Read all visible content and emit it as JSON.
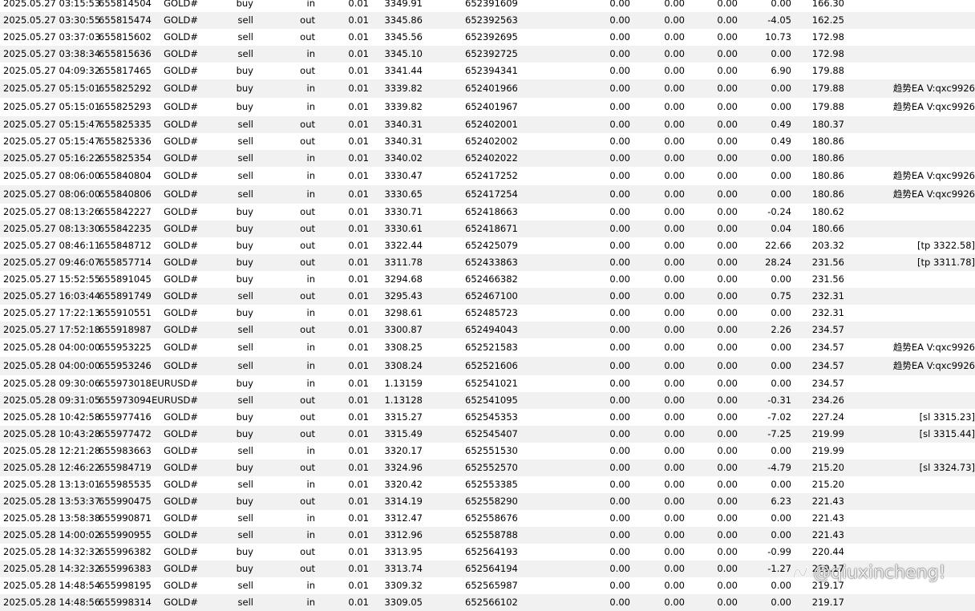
{
  "rows": [
    {
      "time": "2025.05.27 03:15:53",
      "deal": "655814504",
      "symbol": "GOLD#",
      "type": "buy",
      "direction": "in",
      "volume": "0.01",
      "price": "3349.91",
      "order": "652391609",
      "commission": "0.00",
      "fee": "0.00",
      "swap": "0.00",
      "profit": "0.00",
      "balance": "166.30",
      "comment": ""
    },
    {
      "time": "2025.05.27 03:30:55",
      "deal": "655815474",
      "symbol": "GOLD#",
      "type": "sell",
      "direction": "out",
      "volume": "0.01",
      "price": "3345.86",
      "order": "652392563",
      "commission": "0.00",
      "fee": "0.00",
      "swap": "0.00",
      "profit": "-4.05",
      "balance": "162.25",
      "comment": ""
    },
    {
      "time": "2025.05.27 03:37:03",
      "deal": "655815602",
      "symbol": "GOLD#",
      "type": "sell",
      "direction": "out",
      "volume": "0.01",
      "price": "3345.56",
      "order": "652392695",
      "commission": "0.00",
      "fee": "0.00",
      "swap": "0.00",
      "profit": "10.73",
      "balance": "172.98",
      "comment": ""
    },
    {
      "time": "2025.05.27 03:38:34",
      "deal": "655815636",
      "symbol": "GOLD#",
      "type": "sell",
      "direction": "in",
      "volume": "0.01",
      "price": "3345.10",
      "order": "652392725",
      "commission": "0.00",
      "fee": "0.00",
      "swap": "0.00",
      "profit": "0.00",
      "balance": "172.98",
      "comment": ""
    },
    {
      "time": "2025.05.27 04:09:32",
      "deal": "655817465",
      "symbol": "GOLD#",
      "type": "buy",
      "direction": "out",
      "volume": "0.01",
      "price": "3341.44",
      "order": "652394341",
      "commission": "0.00",
      "fee": "0.00",
      "swap": "0.00",
      "profit": "6.90",
      "balance": "179.88",
      "comment": ""
    },
    {
      "time": "2025.05.27 05:15:01",
      "deal": "655825292",
      "symbol": "GOLD#",
      "type": "buy",
      "direction": "in",
      "volume": "0.01",
      "price": "3339.82",
      "order": "652401966",
      "commission": "0.00",
      "fee": "0.00",
      "swap": "0.00",
      "profit": "0.00",
      "balance": "179.88",
      "comment": "趋势EA V:qxc9926"
    },
    {
      "time": "2025.05.27 05:15:01",
      "deal": "655825293",
      "symbol": "GOLD#",
      "type": "buy",
      "direction": "in",
      "volume": "0.01",
      "price": "3339.82",
      "order": "652401967",
      "commission": "0.00",
      "fee": "0.00",
      "swap": "0.00",
      "profit": "0.00",
      "balance": "179.88",
      "comment": "趋势EA V:qxc9926"
    },
    {
      "time": "2025.05.27 05:15:47",
      "deal": "655825335",
      "symbol": "GOLD#",
      "type": "sell",
      "direction": "out",
      "volume": "0.01",
      "price": "3340.31",
      "order": "652402001",
      "commission": "0.00",
      "fee": "0.00",
      "swap": "0.00",
      "profit": "0.49",
      "balance": "180.37",
      "comment": ""
    },
    {
      "time": "2025.05.27 05:15:47",
      "deal": "655825336",
      "symbol": "GOLD#",
      "type": "sell",
      "direction": "out",
      "volume": "0.01",
      "price": "3340.31",
      "order": "652402002",
      "commission": "0.00",
      "fee": "0.00",
      "swap": "0.00",
      "profit": "0.49",
      "balance": "180.86",
      "comment": ""
    },
    {
      "time": "2025.05.27 05:16:22",
      "deal": "655825354",
      "symbol": "GOLD#",
      "type": "sell",
      "direction": "in",
      "volume": "0.01",
      "price": "3340.02",
      "order": "652402022",
      "commission": "0.00",
      "fee": "0.00",
      "swap": "0.00",
      "profit": "0.00",
      "balance": "180.86",
      "comment": ""
    },
    {
      "time": "2025.05.27 08:06:00",
      "deal": "655840804",
      "symbol": "GOLD#",
      "type": "sell",
      "direction": "in",
      "volume": "0.01",
      "price": "3330.47",
      "order": "652417252",
      "commission": "0.00",
      "fee": "0.00",
      "swap": "0.00",
      "profit": "0.00",
      "balance": "180.86",
      "comment": "趋势EA V:qxc9926"
    },
    {
      "time": "2025.05.27 08:06:00",
      "deal": "655840806",
      "symbol": "GOLD#",
      "type": "sell",
      "direction": "in",
      "volume": "0.01",
      "price": "3330.65",
      "order": "652417254",
      "commission": "0.00",
      "fee": "0.00",
      "swap": "0.00",
      "profit": "0.00",
      "balance": "180.86",
      "comment": "趋势EA V:qxc9926"
    },
    {
      "time": "2025.05.27 08:13:26",
      "deal": "655842227",
      "symbol": "GOLD#",
      "type": "buy",
      "direction": "out",
      "volume": "0.01",
      "price": "3330.71",
      "order": "652418663",
      "commission": "0.00",
      "fee": "0.00",
      "swap": "0.00",
      "profit": "-0.24",
      "balance": "180.62",
      "comment": ""
    },
    {
      "time": "2025.05.27 08:13:30",
      "deal": "655842235",
      "symbol": "GOLD#",
      "type": "buy",
      "direction": "out",
      "volume": "0.01",
      "price": "3330.61",
      "order": "652418671",
      "commission": "0.00",
      "fee": "0.00",
      "swap": "0.00",
      "profit": "0.04",
      "balance": "180.66",
      "comment": ""
    },
    {
      "time": "2025.05.27 08:46:11",
      "deal": "655848712",
      "symbol": "GOLD#",
      "type": "buy",
      "direction": "out",
      "volume": "0.01",
      "price": "3322.44",
      "order": "652425079",
      "commission": "0.00",
      "fee": "0.00",
      "swap": "0.00",
      "profit": "22.66",
      "balance": "203.32",
      "comment": "[tp 3322.58]"
    },
    {
      "time": "2025.05.27 09:46:07",
      "deal": "655857714",
      "symbol": "GOLD#",
      "type": "buy",
      "direction": "out",
      "volume": "0.01",
      "price": "3311.78",
      "order": "652433863",
      "commission": "0.00",
      "fee": "0.00",
      "swap": "0.00",
      "profit": "28.24",
      "balance": "231.56",
      "comment": "[tp 3311.78]"
    },
    {
      "time": "2025.05.27 15:52:55",
      "deal": "655891045",
      "symbol": "GOLD#",
      "type": "buy",
      "direction": "in",
      "volume": "0.01",
      "price": "3294.68",
      "order": "652466382",
      "commission": "0.00",
      "fee": "0.00",
      "swap": "0.00",
      "profit": "0.00",
      "balance": "231.56",
      "comment": ""
    },
    {
      "time": "2025.05.27 16:03:44",
      "deal": "655891749",
      "symbol": "GOLD#",
      "type": "sell",
      "direction": "out",
      "volume": "0.01",
      "price": "3295.43",
      "order": "652467100",
      "commission": "0.00",
      "fee": "0.00",
      "swap": "0.00",
      "profit": "0.75",
      "balance": "232.31",
      "comment": ""
    },
    {
      "time": "2025.05.27 17:22:13",
      "deal": "655910551",
      "symbol": "GOLD#",
      "type": "buy",
      "direction": "in",
      "volume": "0.01",
      "price": "3298.61",
      "order": "652485723",
      "commission": "0.00",
      "fee": "0.00",
      "swap": "0.00",
      "profit": "0.00",
      "balance": "232.31",
      "comment": ""
    },
    {
      "time": "2025.05.27 17:52:18",
      "deal": "655918987",
      "symbol": "GOLD#",
      "type": "sell",
      "direction": "out",
      "volume": "0.01",
      "price": "3300.87",
      "order": "652494043",
      "commission": "0.00",
      "fee": "0.00",
      "swap": "0.00",
      "profit": "2.26",
      "balance": "234.57",
      "comment": ""
    },
    {
      "time": "2025.05.28 04:00:00",
      "deal": "655953225",
      "symbol": "GOLD#",
      "type": "sell",
      "direction": "in",
      "volume": "0.01",
      "price": "3308.25",
      "order": "652521583",
      "commission": "0.00",
      "fee": "0.00",
      "swap": "0.00",
      "profit": "0.00",
      "balance": "234.57",
      "comment": "趋势EA V:qxc9926"
    },
    {
      "time": "2025.05.28 04:00:00",
      "deal": "655953246",
      "symbol": "GOLD#",
      "type": "sell",
      "direction": "in",
      "volume": "0.01",
      "price": "3308.24",
      "order": "652521606",
      "commission": "0.00",
      "fee": "0.00",
      "swap": "0.00",
      "profit": "0.00",
      "balance": "234.57",
      "comment": "趋势EA V:qxc9926"
    },
    {
      "time": "2025.05.28 09:30:06",
      "deal": "655973018",
      "symbol": "EURUSD#",
      "type": "buy",
      "direction": "in",
      "volume": "0.01",
      "price": "1.13159",
      "order": "652541021",
      "commission": "0.00",
      "fee": "0.00",
      "swap": "0.00",
      "profit": "0.00",
      "balance": "234.57",
      "comment": ""
    },
    {
      "time": "2025.05.28 09:31:05",
      "deal": "655973094",
      "symbol": "EURUSD#",
      "type": "sell",
      "direction": "out",
      "volume": "0.01",
      "price": "1.13128",
      "order": "652541095",
      "commission": "0.00",
      "fee": "0.00",
      "swap": "0.00",
      "profit": "-0.31",
      "balance": "234.26",
      "comment": ""
    },
    {
      "time": "2025.05.28 10:42:58",
      "deal": "655977416",
      "symbol": "GOLD#",
      "type": "buy",
      "direction": "out",
      "volume": "0.01",
      "price": "3315.27",
      "order": "652545353",
      "commission": "0.00",
      "fee": "0.00",
      "swap": "0.00",
      "profit": "-7.02",
      "balance": "227.24",
      "comment": "[sl 3315.23]"
    },
    {
      "time": "2025.05.28 10:43:28",
      "deal": "655977472",
      "symbol": "GOLD#",
      "type": "buy",
      "direction": "out",
      "volume": "0.01",
      "price": "3315.49",
      "order": "652545407",
      "commission": "0.00",
      "fee": "0.00",
      "swap": "0.00",
      "profit": "-7.25",
      "balance": "219.99",
      "comment": "[sl 3315.44]"
    },
    {
      "time": "2025.05.28 12:21:28",
      "deal": "655983663",
      "symbol": "GOLD#",
      "type": "sell",
      "direction": "in",
      "volume": "0.01",
      "price": "3320.17",
      "order": "652551530",
      "commission": "0.00",
      "fee": "0.00",
      "swap": "0.00",
      "profit": "0.00",
      "balance": "219.99",
      "comment": ""
    },
    {
      "time": "2025.05.28 12:46:22",
      "deal": "655984719",
      "symbol": "GOLD#",
      "type": "buy",
      "direction": "out",
      "volume": "0.01",
      "price": "3324.96",
      "order": "652552570",
      "commission": "0.00",
      "fee": "0.00",
      "swap": "0.00",
      "profit": "-4.79",
      "balance": "215.20",
      "comment": "[sl 3324.73]"
    },
    {
      "time": "2025.05.28 13:13:01",
      "deal": "655985535",
      "symbol": "GOLD#",
      "type": "sell",
      "direction": "in",
      "volume": "0.01",
      "price": "3320.42",
      "order": "652553385",
      "commission": "0.00",
      "fee": "0.00",
      "swap": "0.00",
      "profit": "0.00",
      "balance": "215.20",
      "comment": ""
    },
    {
      "time": "2025.05.28 13:53:37",
      "deal": "655990475",
      "symbol": "GOLD#",
      "type": "buy",
      "direction": "out",
      "volume": "0.01",
      "price": "3314.19",
      "order": "652558290",
      "commission": "0.00",
      "fee": "0.00",
      "swap": "0.00",
      "profit": "6.23",
      "balance": "221.43",
      "comment": ""
    },
    {
      "time": "2025.05.28 13:58:38",
      "deal": "655990871",
      "symbol": "GOLD#",
      "type": "sell",
      "direction": "in",
      "volume": "0.01",
      "price": "3312.47",
      "order": "652558676",
      "commission": "0.00",
      "fee": "0.00",
      "swap": "0.00",
      "profit": "0.00",
      "balance": "221.43",
      "comment": ""
    },
    {
      "time": "2025.05.28 14:00:02",
      "deal": "655990955",
      "symbol": "GOLD#",
      "type": "sell",
      "direction": "in",
      "volume": "0.01",
      "price": "3312.96",
      "order": "652558788",
      "commission": "0.00",
      "fee": "0.00",
      "swap": "0.00",
      "profit": "0.00",
      "balance": "221.43",
      "comment": ""
    },
    {
      "time": "2025.05.28 14:32:32",
      "deal": "655996382",
      "symbol": "GOLD#",
      "type": "buy",
      "direction": "out",
      "volume": "0.01",
      "price": "3313.95",
      "order": "652564193",
      "commission": "0.00",
      "fee": "0.00",
      "swap": "0.00",
      "profit": "-0.99",
      "balance": "220.44",
      "comment": ""
    },
    {
      "time": "2025.05.28 14:32:32",
      "deal": "655996383",
      "symbol": "GOLD#",
      "type": "buy",
      "direction": "out",
      "volume": "0.01",
      "price": "3313.74",
      "order": "652564194",
      "commission": "0.00",
      "fee": "0.00",
      "swap": "0.00",
      "profit": "-1.27",
      "balance": "219.17",
      "comment": ""
    },
    {
      "time": "2025.05.28 14:48:54",
      "deal": "655998195",
      "symbol": "GOLD#",
      "type": "sell",
      "direction": "in",
      "volume": "0.01",
      "price": "3309.32",
      "order": "652565987",
      "commission": "0.00",
      "fee": "0.00",
      "swap": "0.00",
      "profit": "0.00",
      "balance": "219.17",
      "comment": ""
    },
    {
      "time": "2025.05.28 14:48:56",
      "deal": "655998314",
      "symbol": "GOLD#",
      "type": "sell",
      "direction": "in",
      "volume": "0.01",
      "price": "3309.05",
      "order": "652566102",
      "commission": "0.00",
      "fee": "0.00",
      "swap": "0.00",
      "profit": "0.00",
      "balance": "219.17",
      "comment": ""
    }
  ],
  "watermark": {
    "text": "@qiuxincheng!",
    "icon": "wechat-channel-icon"
  },
  "colors": {
    "row_alt": "#f1f1f1",
    "text": "#000000"
  }
}
